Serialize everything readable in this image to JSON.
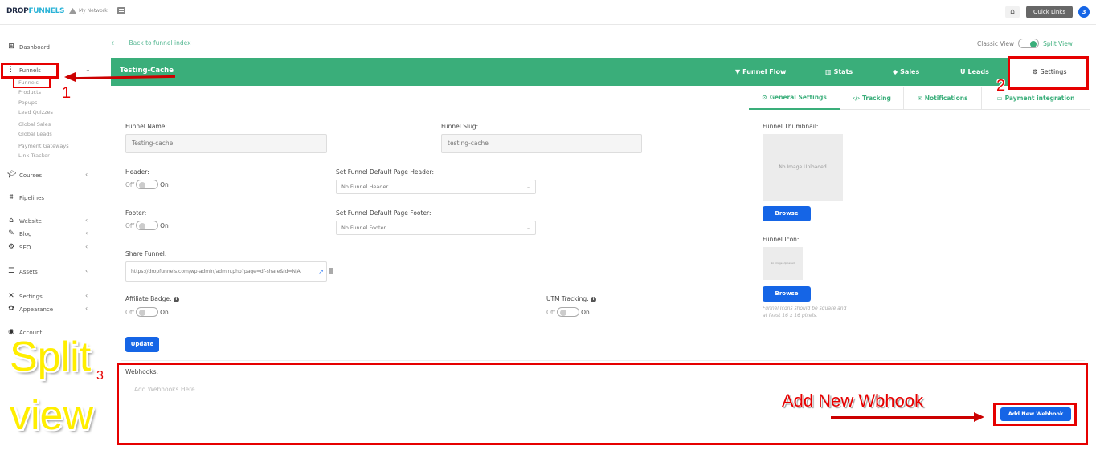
{
  "topbar": {
    "logo_part1": "DROP",
    "logo_part2": "FUNNELS",
    "my_network": "My Network",
    "quick_links": "Quick Links",
    "notification_count": "3"
  },
  "sidebar": {
    "items": [
      {
        "label": "Dashboard",
        "icon": "dashboard-icon"
      },
      {
        "label": "Funnels",
        "icon": "funnels-icon"
      },
      {
        "label": "Courses",
        "icon": "courses-icon"
      },
      {
        "label": "Pipelines",
        "icon": "pipelines-icon"
      },
      {
        "label": "Website",
        "icon": "website-icon"
      },
      {
        "label": "Blog",
        "icon": "blog-icon"
      },
      {
        "label": "SEO",
        "icon": "seo-icon"
      },
      {
        "label": "Assets",
        "icon": "assets-icon"
      },
      {
        "label": "Settings",
        "icon": "settings-icon"
      },
      {
        "label": "Appearance",
        "icon": "appearance-icon"
      },
      {
        "label": "Account",
        "icon": "account-icon"
      }
    ],
    "funnels_sub": [
      "Funnels",
      "Products",
      "Popups",
      "Lead Quizzes",
      "Global Sales",
      "Global Leads",
      "Payment Gateways",
      "Link Tracker"
    ]
  },
  "main": {
    "back_link": "Back to funnel index",
    "classic_view": "Classic View",
    "split_view": "Split View",
    "funnel_title": "Testing-Cache",
    "top_tabs": [
      "Funnel Flow",
      "Stats",
      "Sales",
      "Leads",
      "Settings"
    ],
    "sub_tabs": [
      "General Settings",
      "Tracking",
      "Notifications",
      "Payment integration"
    ],
    "form": {
      "funnel_name_label": "Funnel Name:",
      "funnel_name_value": "Testing-cache",
      "funnel_slug_label": "Funnel Slug:",
      "funnel_slug_value": "testing-cache",
      "header_label": "Header:",
      "footer_label": "Footer:",
      "off": "Off",
      "on": "On",
      "default_header_label": "Set Funnel Default Page Header:",
      "default_header_value": "No Funnel Header",
      "default_footer_label": "Set Funnel Default Page Footer:",
      "default_footer_value": "No Funnel Footer",
      "share_label": "Share Funnel:",
      "share_url": "https://dropfunnels.com/wp-admin/admin.php?page=df-share&id=NjA",
      "affiliate_label": "Affiliate Badge:",
      "utm_label": "UTM Tracking:",
      "update_button": "Update",
      "thumbnail_label": "Funnel Thumbnail:",
      "no_image": "No Image Uploaded",
      "browse": "Browse",
      "icon_label": "Funnel Icon:",
      "icon_hint": "Funnel Icons should be square and at least 16 x 16 pixels."
    },
    "webhooks": {
      "label": "Webhooks:",
      "placeholder": "Add Webhooks Here",
      "add_button": "Add New Webhook"
    }
  },
  "annotations": {
    "num1": "1",
    "num2": "2",
    "num3": "3",
    "split_line1": "Split",
    "split_line2": "view",
    "add_new": "Add New Wbhook"
  }
}
